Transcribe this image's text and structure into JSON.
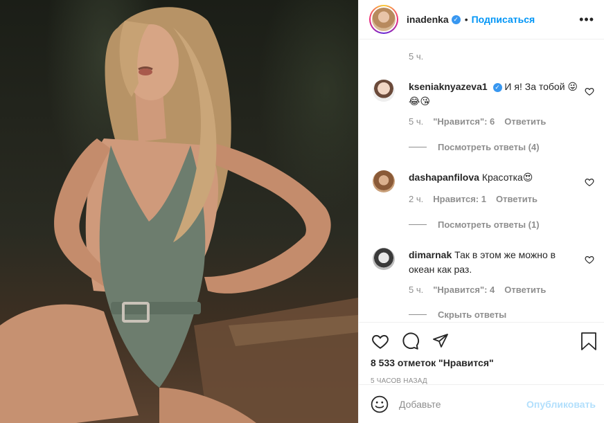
{
  "post": {
    "username": "inadenka",
    "follow_label": "Подписаться",
    "dot": "•"
  },
  "comments": {
    "previous_time": "5 ч.",
    "items": [
      {
        "username": "kseniaknyazeva1",
        "verified": true,
        "text": "И я! За тобой 😜😂😘",
        "time": "5 ч.",
        "likes": "\"Нравится\": 6",
        "reply": "Ответить",
        "view_replies": "Посмотреть ответы (4)"
      },
      {
        "username": "dashapanfilova",
        "verified": false,
        "text": "Красотка😍",
        "time": "2 ч.",
        "likes": "Нравится: 1",
        "reply": "Ответить",
        "view_replies": "Посмотреть ответы (1)"
      },
      {
        "username": "dimarnak",
        "verified": false,
        "text": "Так в этом же можно в океан как раз.",
        "time": "5 ч.",
        "likes": "\"Нравится\": 4",
        "reply": "Ответить",
        "view_replies": "Скрыть ответы"
      }
    ]
  },
  "footer": {
    "likes_count": "8 533 отметок \"Нравится\"",
    "timestamp": "5 часов назад",
    "comment_placeholder": "Добавьте",
    "publish_label": "Опубликовать"
  },
  "icons": {
    "like": "heart-icon",
    "comment": "comment-icon",
    "share": "share-icon",
    "save": "bookmark-icon",
    "emoji": "emoji-icon",
    "more": "more-options-icon",
    "verified": "verified-badge-icon"
  },
  "colors": {
    "link": "#0095f6",
    "verified": "#3897f0",
    "muted": "#8e8e8e",
    "publish_disabled": "#b2dffc"
  }
}
